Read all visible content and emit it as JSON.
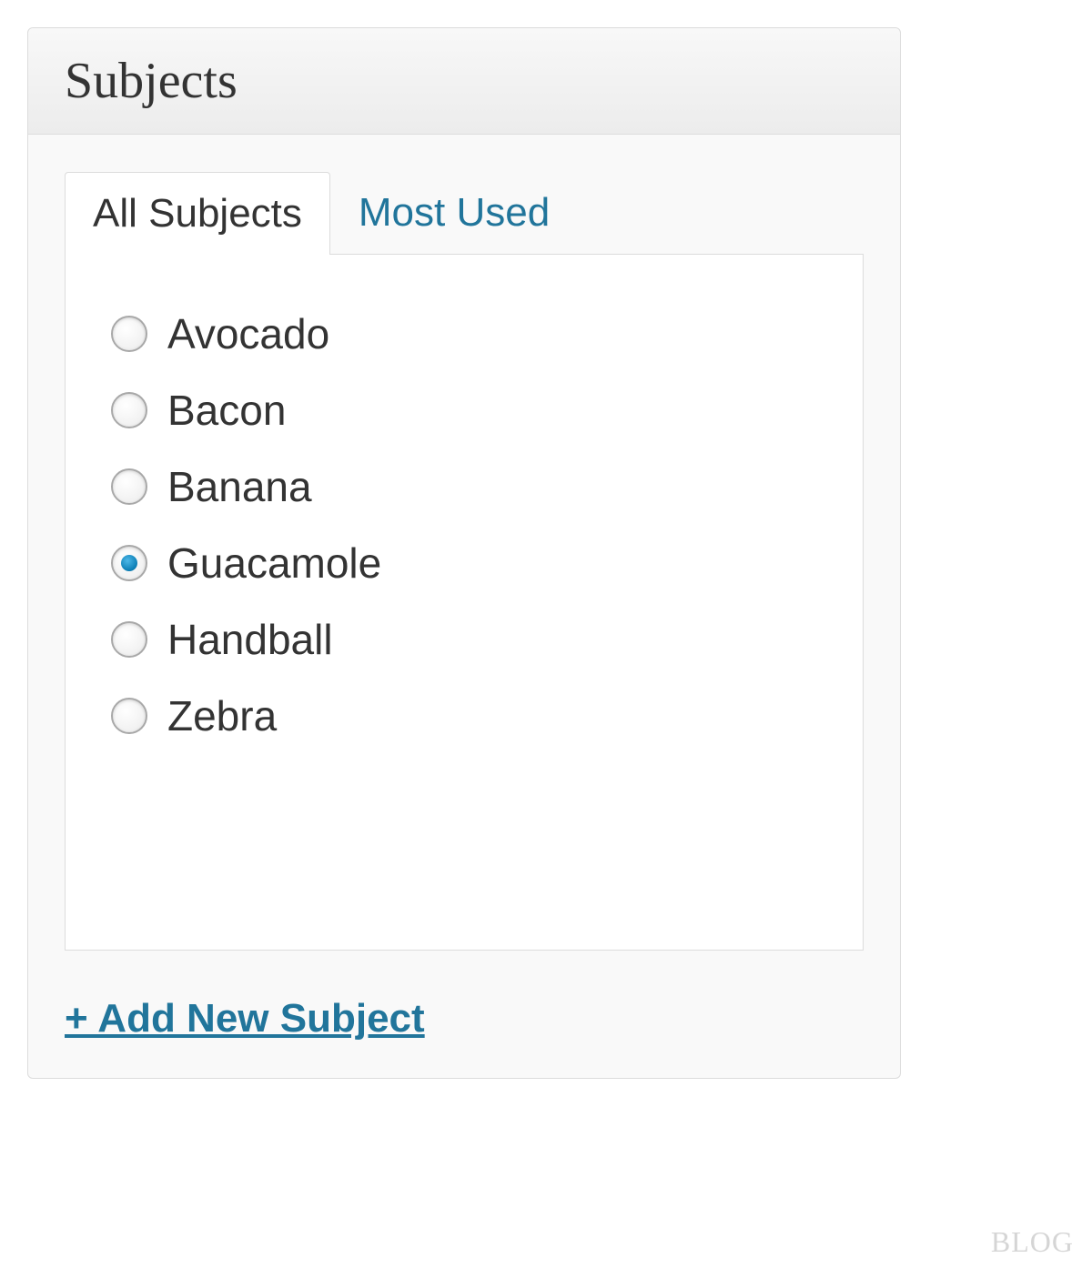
{
  "panel": {
    "title": "Subjects",
    "tabs": [
      {
        "label": "All Subjects",
        "active": true
      },
      {
        "label": "Most Used",
        "active": false
      }
    ],
    "subjects": [
      {
        "label": "Avocado",
        "checked": false
      },
      {
        "label": "Bacon",
        "checked": false
      },
      {
        "label": "Banana",
        "checked": false
      },
      {
        "label": "Guacamole",
        "checked": true
      },
      {
        "label": "Handball",
        "checked": false
      },
      {
        "label": "Zebra",
        "checked": false
      }
    ],
    "add_new_label": "+ Add New Subject"
  },
  "watermark": "BLOG"
}
